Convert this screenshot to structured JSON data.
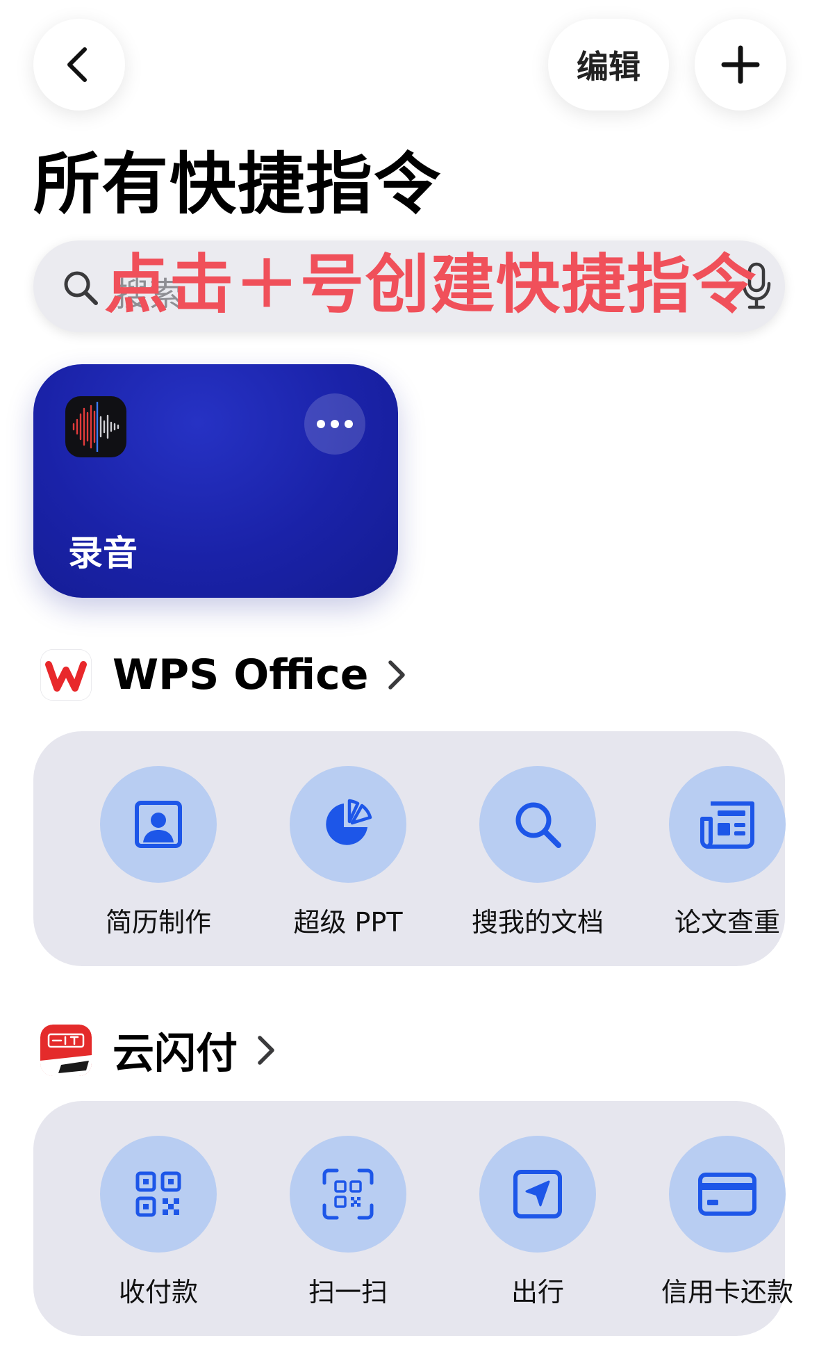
{
  "top_bar": {
    "edit_label": "编辑"
  },
  "page_title": "所有快捷指令",
  "search": {
    "placeholder": "搜索"
  },
  "annotation": "点击＋号创建快捷指令",
  "shortcut_card": {
    "label": "录音",
    "color": "#1a22a8"
  },
  "sections": [
    {
      "title": "WPS Office",
      "actions": [
        {
          "label": "简历制作",
          "icon": "person-card-icon"
        },
        {
          "label": "超级 PPT",
          "icon": "pie-chart-icon"
        },
        {
          "label": "搜我的文档",
          "icon": "search-icon"
        },
        {
          "label": "论文查重",
          "icon": "newspaper-icon"
        }
      ]
    },
    {
      "title": "云闪付",
      "actions": [
        {
          "label": "收付款",
          "icon": "qr-code-icon"
        },
        {
          "label": "扫一扫",
          "icon": "scan-icon"
        },
        {
          "label": "出行",
          "icon": "navigation-arrow-icon"
        },
        {
          "label": "信用卡还款",
          "icon": "credit-card-icon"
        }
      ]
    }
  ],
  "colors": {
    "accent_blue": "#1d56e8",
    "action_circle": "#b8cdf2",
    "panel_bg": "#e6e6ee",
    "annotation_red": "#f0505a"
  }
}
